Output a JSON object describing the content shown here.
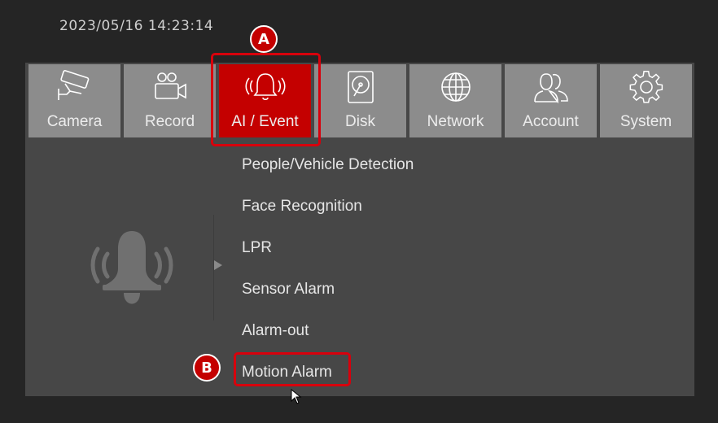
{
  "header": {
    "datetime": "2023/05/16 14:23:14"
  },
  "tabs": [
    {
      "label": "Camera",
      "icon": "cctv-camera-icon"
    },
    {
      "label": "Record",
      "icon": "video-camera-icon"
    },
    {
      "label": "AI / Event",
      "icon": "alarm-bell-icon",
      "active": true
    },
    {
      "label": "Disk",
      "icon": "hard-disk-icon"
    },
    {
      "label": "Network",
      "icon": "globe-icon"
    },
    {
      "label": "Account",
      "icon": "users-icon"
    },
    {
      "label": "System",
      "icon": "gear-icon"
    }
  ],
  "submenu": {
    "items": [
      {
        "label": "People/Vehicle Detection"
      },
      {
        "label": "Face Recognition"
      },
      {
        "label": "LPR"
      },
      {
        "label": "Sensor Alarm"
      },
      {
        "label": "Alarm-out"
      },
      {
        "label": "Motion Alarm",
        "highlighted": true
      }
    ]
  },
  "annotations": {
    "a": "A",
    "b": "B"
  },
  "colors": {
    "accent": "#c40000",
    "tab_bg": "#8c8c8c",
    "panel_bg": "#474747",
    "page_bg": "#252525"
  }
}
